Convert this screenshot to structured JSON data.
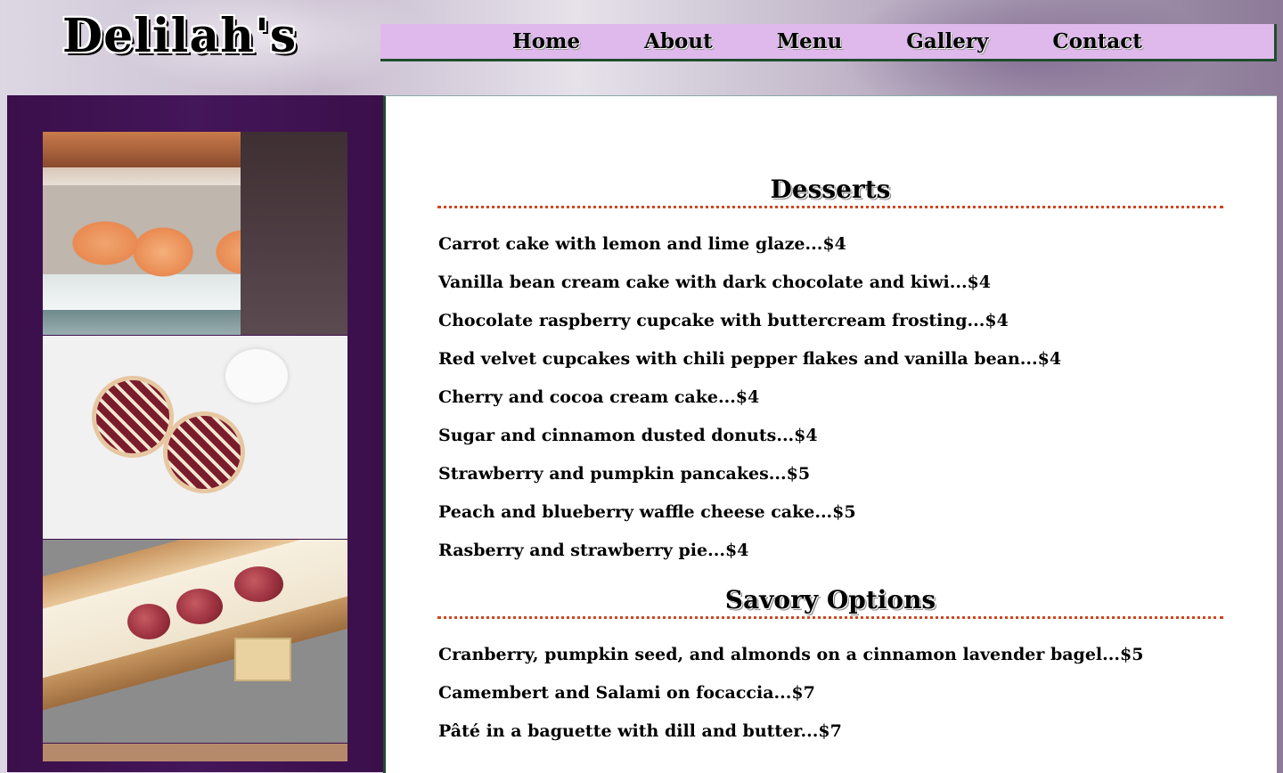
{
  "site": {
    "title": "Delilah's"
  },
  "nav": {
    "items": [
      {
        "label": "Home"
      },
      {
        "label": "About"
      },
      {
        "label": "Menu"
      },
      {
        "label": "Gallery"
      },
      {
        "label": "Contact"
      }
    ]
  },
  "colors": {
    "nav_bg": "#dfb9ec",
    "sidebar_bg": "#44165a",
    "accent_border": "#1f4d2c",
    "divider": "#d2451e"
  },
  "menu": {
    "desserts": {
      "title": "Desserts",
      "items": [
        "Carrot cake with lemon and lime glaze...$4",
        "Vanilla bean cream cake with dark chocolate and kiwi...$4",
        "Chocolate raspberry cupcake with buttercream frosting...$4",
        "Red velvet cupcakes with chili pepper flakes and vanilla bean...$4",
        "Cherry and cocoa cream cake...$4",
        "Sugar and cinnamon dusted donuts...$4",
        "Strawberry and pumpkin pancakes...$5",
        "Peach and blueberry waffle cheese cake...$5",
        "Rasberry and strawberry pie...$4"
      ]
    },
    "savory": {
      "title": "Savory Options",
      "items": [
        "Cranberry, pumpkin seed, and almonds on a cinnamon lavender bagel...$5",
        "Camembert and Salami on focaccia...$7",
        "Pâté in a baguette with dill and butter...$7"
      ]
    }
  }
}
